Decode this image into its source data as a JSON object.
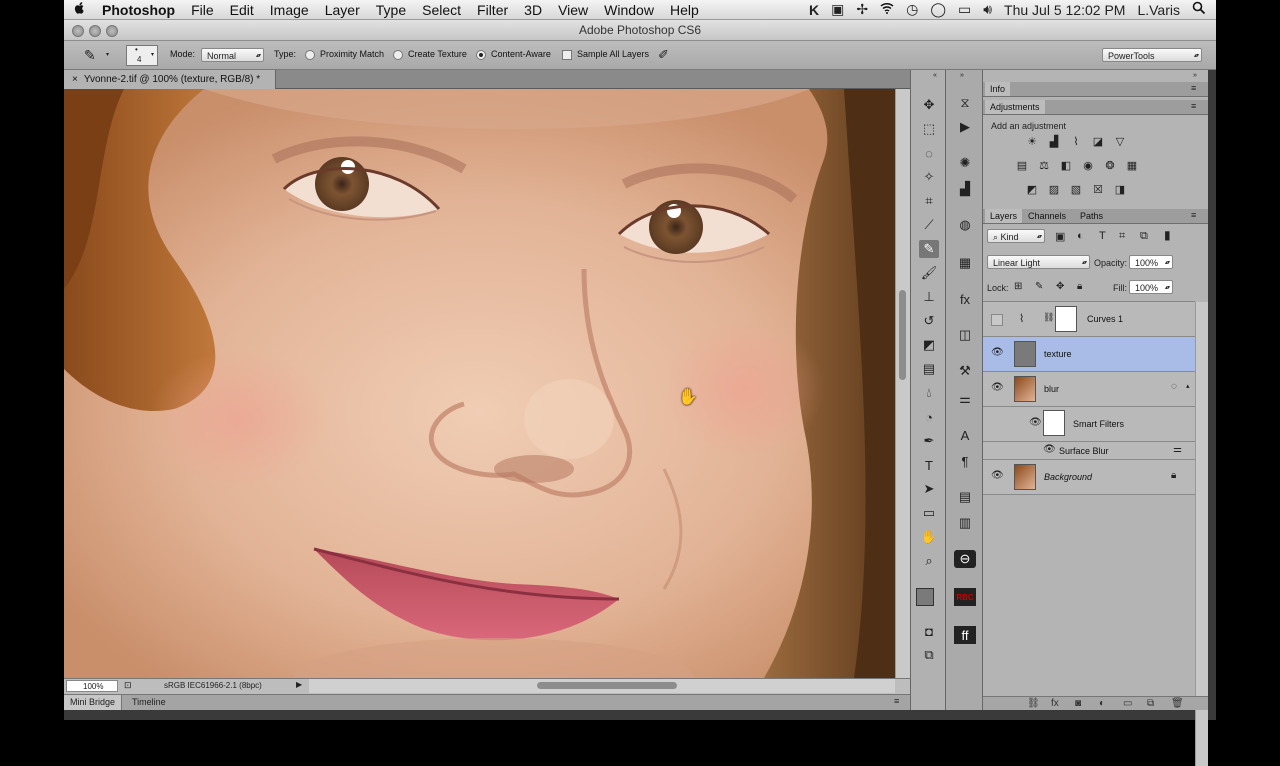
{
  "menubar": {
    "apple": "",
    "app": "Photoshop",
    "items": [
      "File",
      "Edit",
      "Image",
      "Layer",
      "Type",
      "Select",
      "Filter",
      "3D",
      "View",
      "Window",
      "Help"
    ],
    "clock": "Thu Jul 5  12:02 PM",
    "user": "L.Varis"
  },
  "window": {
    "title": "Adobe Photoshop CS6"
  },
  "options": {
    "brush_size": "4",
    "mode_label": "Mode:",
    "mode_value": "Normal",
    "type_label": "Type:",
    "types": [
      "Proximity Match",
      "Create Texture",
      "Content-Aware"
    ],
    "selected_type": "Content-Aware",
    "sample_all_layers": "Sample All Layers",
    "workspace": "PowerTools"
  },
  "document": {
    "tab": "Yvonne-2.tif @ 100% (texture, RGB/8) *",
    "zoom": "100%",
    "profile": "sRGB IEC61966-2.1 (8bpc)"
  },
  "bottom_tabs": [
    "Mini Bridge",
    "Timeline"
  ],
  "panels": {
    "info_tab": "Info",
    "adjustments_tab": "Adjustments",
    "add_adjustment": "Add an adjustment",
    "layer_tabs": [
      "Layers",
      "Channels",
      "Paths"
    ],
    "filter_kind": "Kind",
    "blend_mode": "Linear Light",
    "opacity_label": "Opacity:",
    "opacity": "100%",
    "lock_label": "Lock:",
    "fill_label": "Fill:",
    "fill": "100%"
  },
  "layers": [
    {
      "name": "Curves 1",
      "visible": false,
      "selected": false
    },
    {
      "name": "texture",
      "visible": true,
      "selected": true
    },
    {
      "name": "blur",
      "visible": true,
      "selected": false
    },
    {
      "name": "Smart Filters",
      "visible": true,
      "selected": false
    },
    {
      "name": "Surface Blur",
      "visible": true,
      "selected": false
    },
    {
      "name": "Background",
      "visible": true,
      "selected": false
    }
  ],
  "colors": {
    "selected_layer": "#a9bce8",
    "skin": "#e2b79a",
    "hair": "#a8602a",
    "lips": "#c84e62"
  }
}
